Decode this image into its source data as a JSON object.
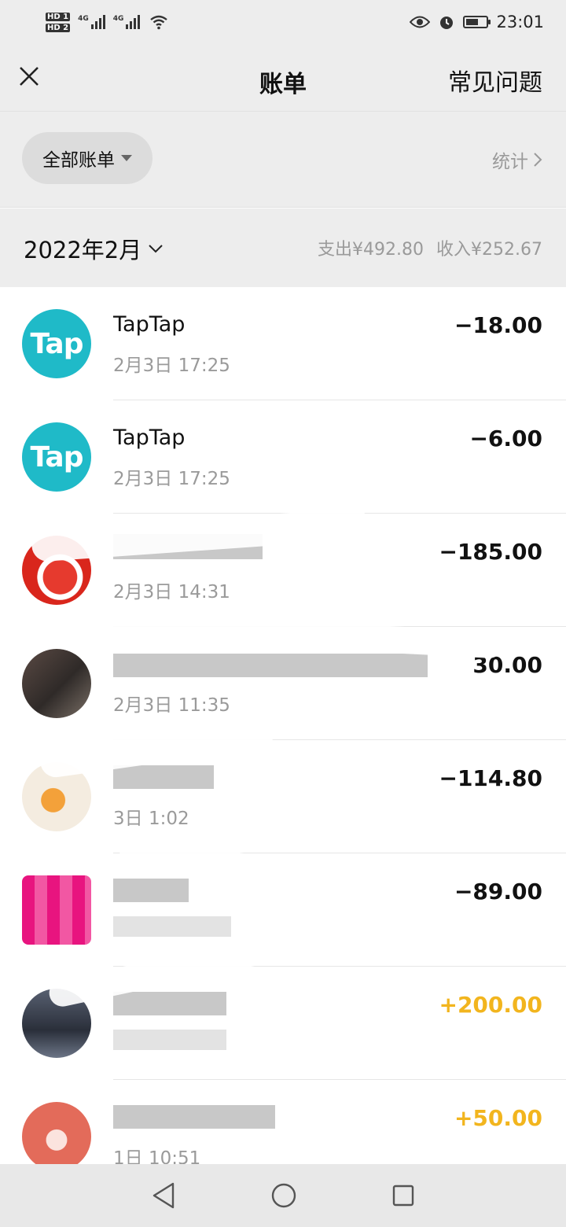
{
  "status_bar": {
    "hd1": "HD 1",
    "hd2": "HD 2",
    "net1": "4G",
    "net2": "4G",
    "time": "23:01",
    "battery_level": 0.6
  },
  "nav": {
    "title": "账单",
    "faq_label": "常见问题"
  },
  "filter": {
    "all_bills_label": "全部账单",
    "stats_label": "统计"
  },
  "month": {
    "label": "2022年2月",
    "expense_summary": "支出¥492.80",
    "income_summary": "收入¥252.67"
  },
  "transactions": [
    {
      "name": "TapTap",
      "time": "2月3日 17:25",
      "amount": "−18.00",
      "type": "expense",
      "avatar_text": "Tap"
    },
    {
      "name": "TapTap",
      "time": "2月3日 17:25",
      "amount": "−6.00",
      "type": "expense",
      "avatar_text": "Tap"
    },
    {
      "name": "",
      "time": "2月3日 14:31",
      "amount": "−185.00",
      "type": "expense"
    },
    {
      "name": "",
      "time": "2月3日 11:35",
      "amount": "30.00",
      "type": "expense"
    },
    {
      "name": "",
      "time": "3日 1:02",
      "amount": "−114.80",
      "type": "expense"
    },
    {
      "name": "",
      "time": "",
      "amount": "−89.00",
      "type": "expense"
    },
    {
      "name": "",
      "time": "",
      "amount": "+200.00",
      "type": "income"
    },
    {
      "name": "",
      "time": "1日 10:51",
      "amount": "+50.00",
      "type": "income"
    }
  ],
  "colors": {
    "income": "#f2b51e",
    "tap_brand": "#1fbac8"
  }
}
